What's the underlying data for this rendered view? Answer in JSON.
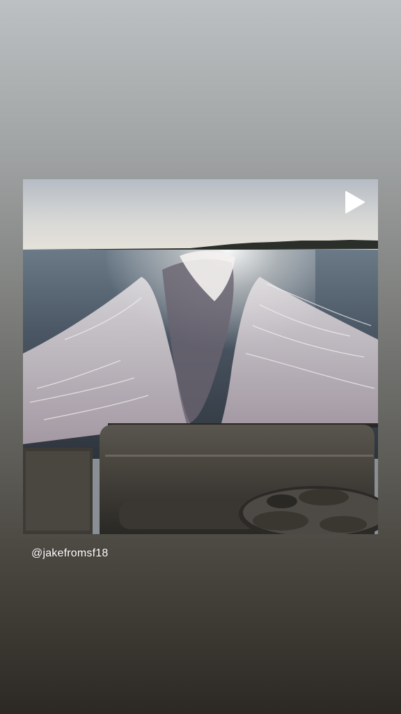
{
  "story": {
    "media_kind": "video",
    "mention": "@jakefromsf18"
  },
  "icons": {
    "play": "play-icon"
  },
  "colors": {
    "text": "#ffffff",
    "background_top": "#bcc0c2",
    "background_bottom": "#2c2924"
  }
}
